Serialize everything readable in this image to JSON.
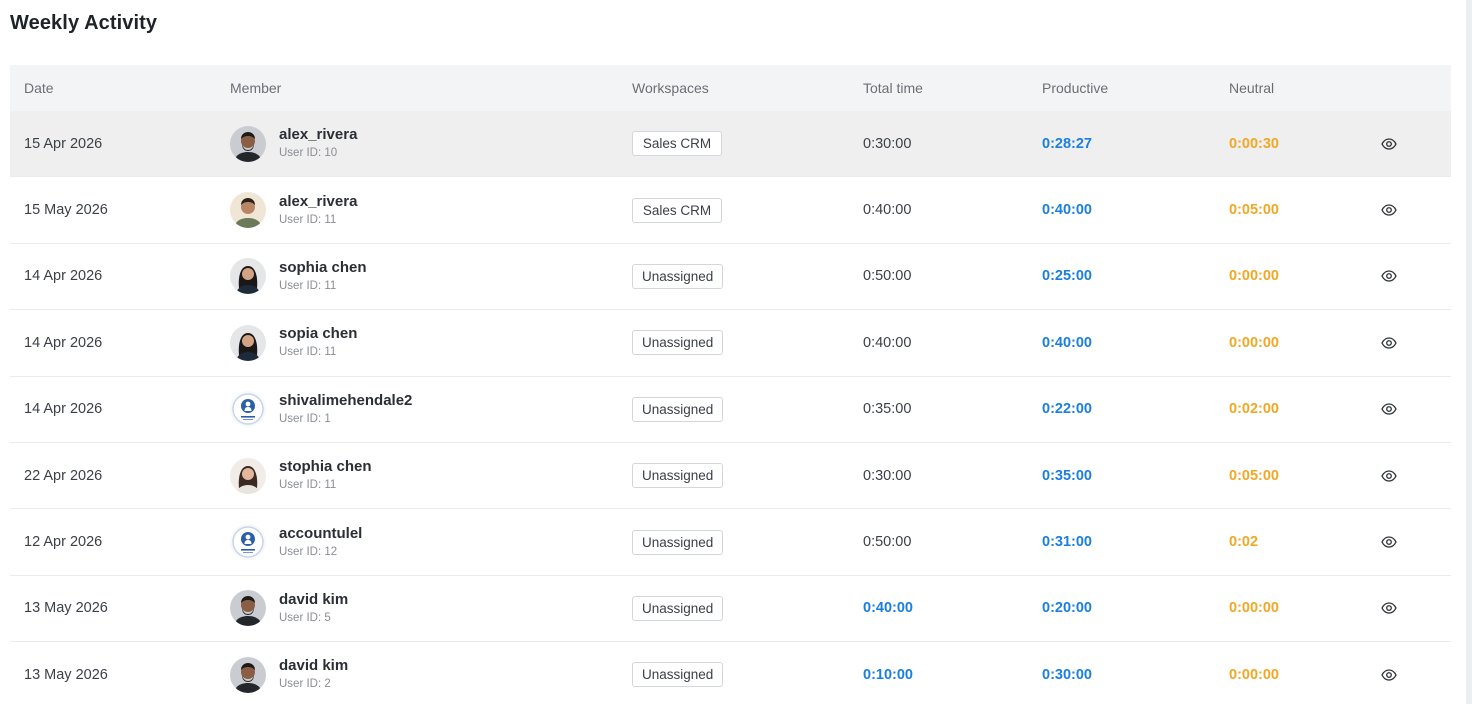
{
  "page": {
    "title": "Weekly Activity"
  },
  "table": {
    "headers": {
      "date": "Date",
      "member": "Member",
      "workspaces": "Workspaces",
      "total_time": "Total time",
      "productive": "Productive",
      "neutral": "Neutral"
    },
    "rows": [
      {
        "date": "15 Apr 2026",
        "name": "alex_rivera",
        "user_id": "User ID: 10",
        "workspace": "Sales CRM",
        "total": "0:30:00",
        "total_blue": false,
        "productive": "0:28:27",
        "neutral": "0:00:30",
        "avatar": "man-dark",
        "highlighted": true
      },
      {
        "date": "15 May 2026",
        "name": "alex_rivera",
        "user_id": "User ID: 11",
        "workspace": "Sales CRM",
        "total": "0:40:00",
        "total_blue": false,
        "productive": "0:40:00",
        "neutral": "0:05:00",
        "avatar": "man-light",
        "highlighted": false
      },
      {
        "date": "14 Apr 2026",
        "name": "sophia chen",
        "user_id": "User ID: 11",
        "workspace": "Unassigned",
        "total": "0:50:00",
        "total_blue": false,
        "productive": "0:25:00",
        "neutral": "0:00:00",
        "avatar": "woman-dark",
        "highlighted": false
      },
      {
        "date": "14 Apr 2026",
        "name": "sopia chen",
        "user_id": "User ID: 11",
        "workspace": "Unassigned",
        "total": "0:40:00",
        "total_blue": false,
        "productive": "0:40:00",
        "neutral": "0:00:00",
        "avatar": "woman-dark",
        "highlighted": false
      },
      {
        "date": "14 Apr 2026",
        "name": "shivalimehendale2",
        "user_id": "User ID: 1",
        "workspace": "Unassigned",
        "total": "0:35:00",
        "total_blue": false,
        "productive": "0:22:00",
        "neutral": "0:02:00",
        "avatar": "logo",
        "highlighted": false
      },
      {
        "date": "22 Apr 2026",
        "name": "stophia chen",
        "user_id": "User ID: 11",
        "workspace": "Unassigned",
        "total": "0:30:00",
        "total_blue": false,
        "productive": "0:35:00",
        "neutral": "0:05:00",
        "avatar": "woman-light",
        "highlighted": false
      },
      {
        "date": "12 Apr 2026",
        "name": "accountulel",
        "user_id": "User ID: 12",
        "workspace": "Unassigned",
        "total": "0:50:00",
        "total_blue": false,
        "productive": "0:31:00",
        "neutral": "0:02",
        "avatar": "logo",
        "highlighted": false
      },
      {
        "date": "13 May 2026",
        "name": "david kim",
        "user_id": "User ID: 5",
        "workspace": "Unassigned",
        "total": "0:40:00",
        "total_blue": true,
        "productive": "0:20:00",
        "neutral": "0:00:00",
        "avatar": "man-dark",
        "highlighted": false
      },
      {
        "date": "13 May 2026",
        "name": "david kim",
        "user_id": "User ID: 2",
        "workspace": "Unassigned",
        "total": "0:10:00",
        "total_blue": true,
        "productive": "0:30:00",
        "neutral": "0:00:00",
        "avatar": "man-dark",
        "highlighted": false
      }
    ],
    "row_action_icon": "eye-icon"
  },
  "colors": {
    "productive": "#1a7fe0",
    "neutral": "#f0a825",
    "header_bg": "#f3f4f6",
    "highlight_row": "#efefef"
  }
}
